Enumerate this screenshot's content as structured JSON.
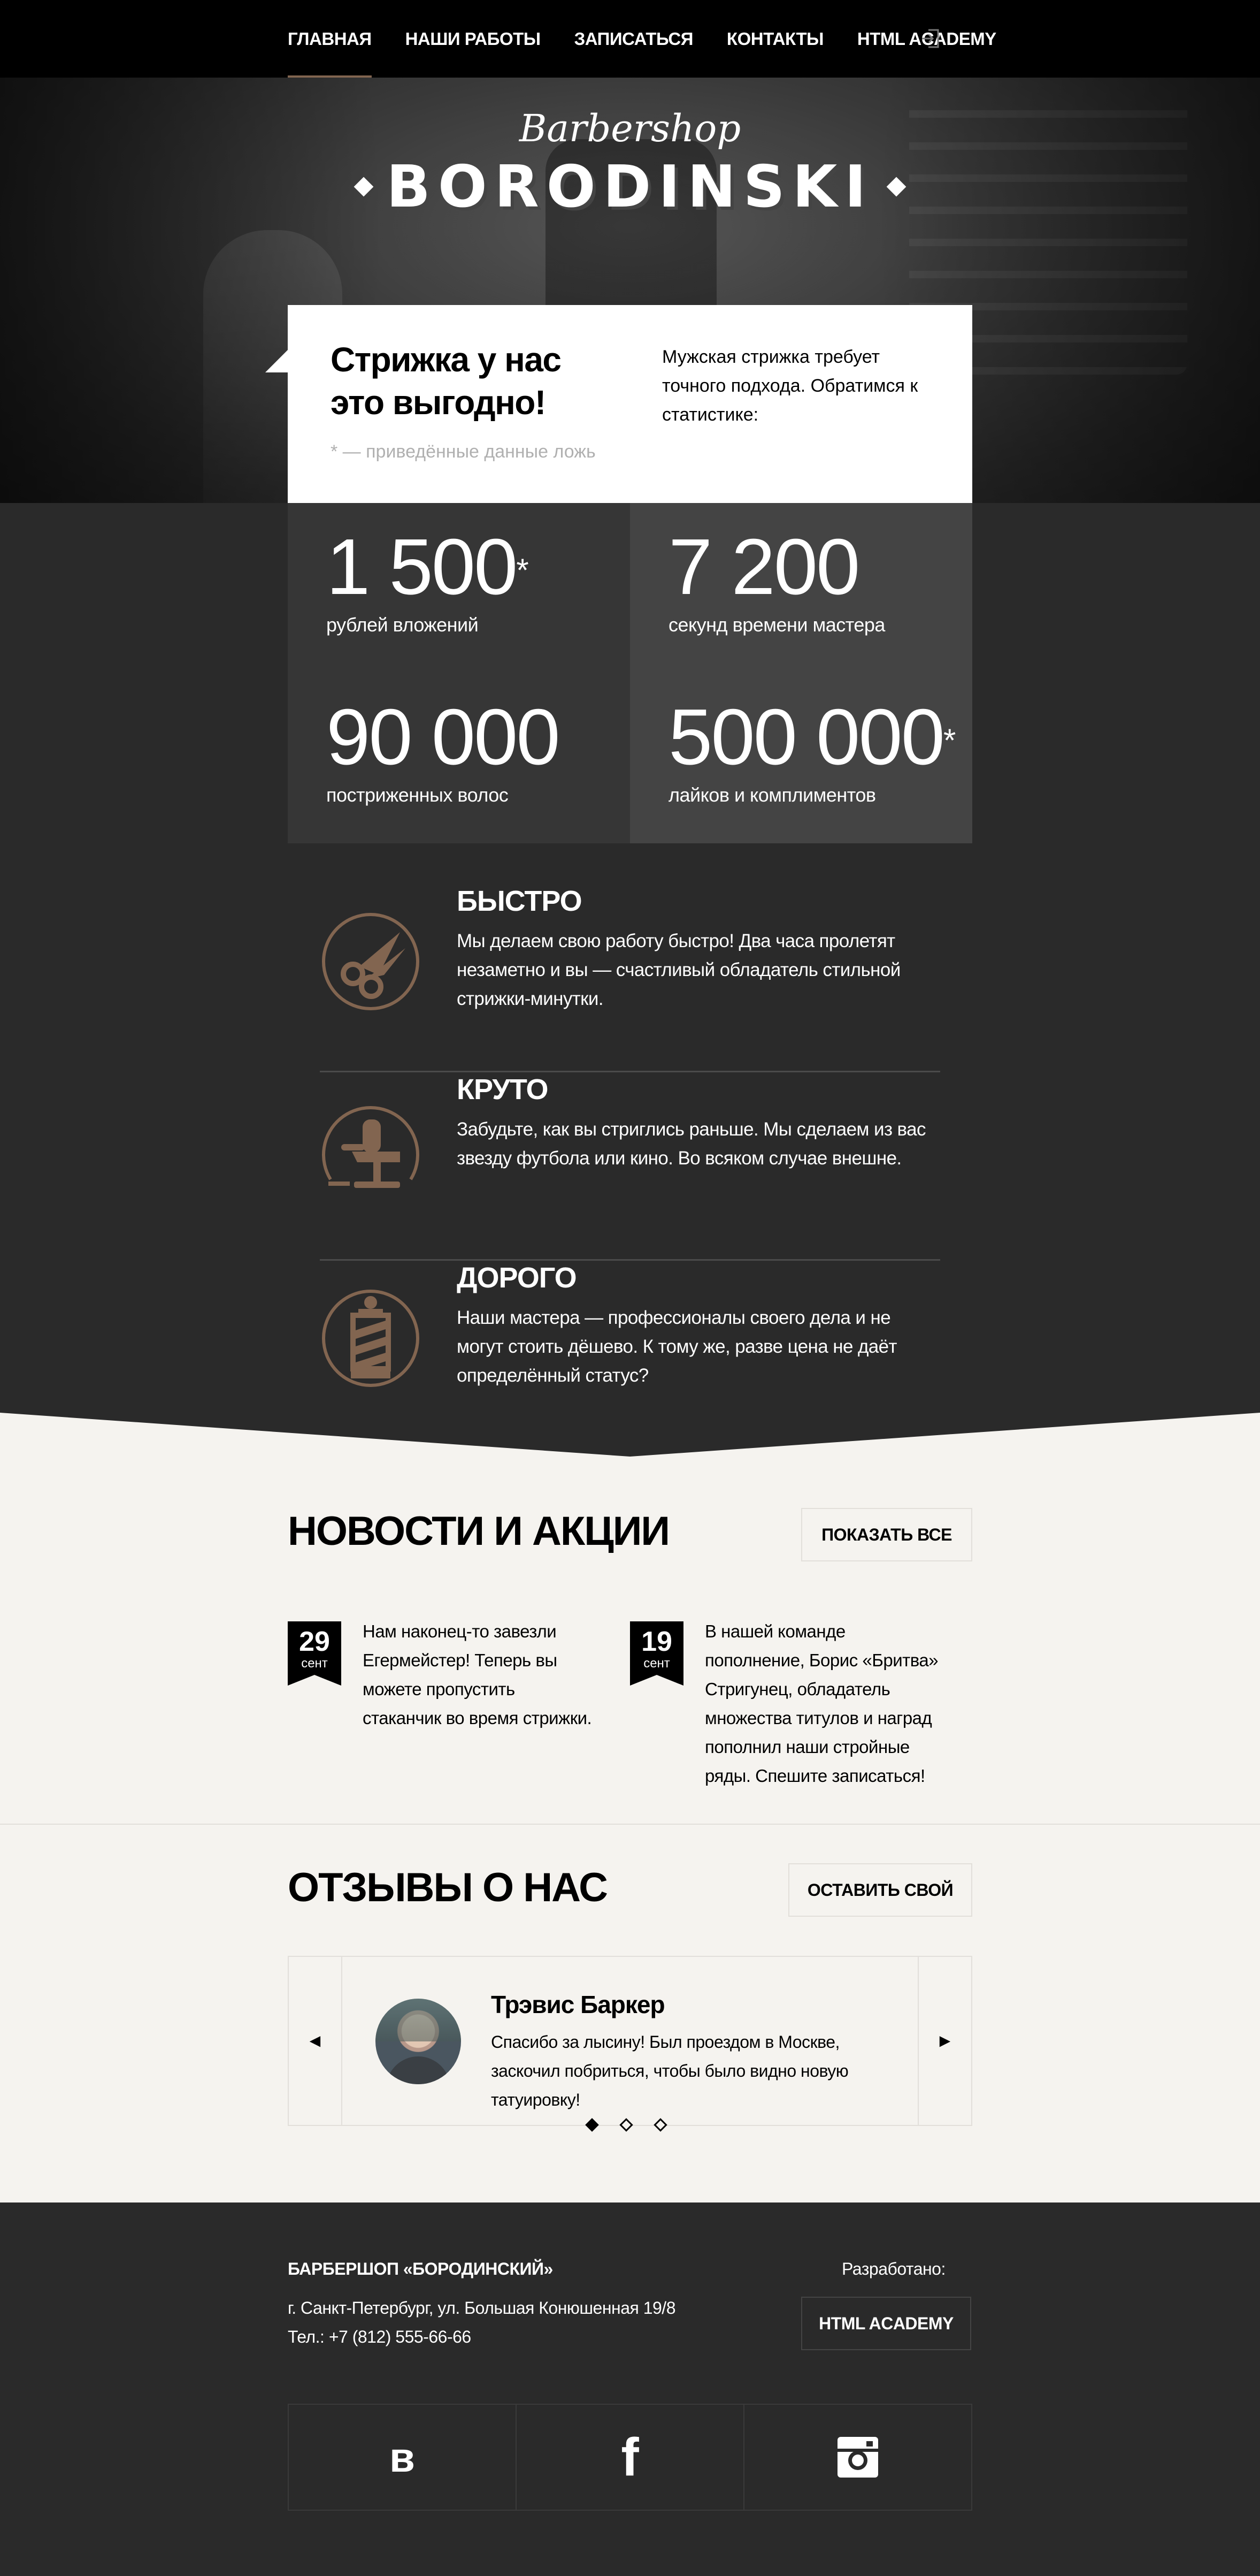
{
  "nav": {
    "items": [
      {
        "label": "ГЛАВНАЯ",
        "active": true
      },
      {
        "label": "НАШИ РАБОТЫ",
        "active": false
      },
      {
        "label": "ЗАПИСАТЬСЯ",
        "active": false
      },
      {
        "label": "КОНТАКТЫ",
        "active": false
      },
      {
        "label": "HTML ACADEMY",
        "active": false
      }
    ],
    "login_icon": "login-icon"
  },
  "logo": {
    "script": "Barbershop",
    "brand": "BORODINSKI"
  },
  "intro": {
    "title": "Стрижка у нас это выгодно!",
    "note": "* — приведённые данные ложь",
    "description": "Мужская стрижка требует точного подхода. Обратимся к статистике:"
  },
  "stats": [
    {
      "value": "1 500",
      "asterisk": "*",
      "label": "рублей вложений"
    },
    {
      "value": "7 200",
      "asterisk": "",
      "label": "секунд времени мастера"
    },
    {
      "value": "90 000",
      "asterisk": "",
      "label": "постриженных волос"
    },
    {
      "value": "500 000",
      "asterisk": "*",
      "label": "лайков и комплиментов"
    }
  ],
  "features": [
    {
      "icon": "scissors-icon",
      "title": "БЫСТРО",
      "text": "Мы делаем свою работу быстро! Два часа пролетят незаметно и вы — счастливый обладатель стильной стрижки-минутки."
    },
    {
      "icon": "barber-chair-icon",
      "title": "КРУТО",
      "text": "Забудьте, как вы стриглись раньше. Мы сделаем из вас звезду футбола или кино. Во всяком случае внешне."
    },
    {
      "icon": "barber-pole-icon",
      "title": "ДОРОГО",
      "text": "Наши мастера — профессионалы своего дела и не могут стоить дёшево. К тому же, разве цена не даёт определённый статус?"
    }
  ],
  "colors": {
    "accent": "#826550",
    "dark_bg": "#2a2a2a",
    "light_bg": "#f5f3ef",
    "stat_dark": "#363636",
    "stat_light": "#444444"
  },
  "news": {
    "title": "НОВОСТИ И АКЦИИ",
    "button": "ПОКАЗАТЬ ВСЕ",
    "items": [
      {
        "day": "29",
        "month": "сент",
        "text": "Нам наконец-то завезли Егермейстер! Теперь вы можете пропустить стаканчик во время стрижки."
      },
      {
        "day": "19",
        "month": "сент",
        "text": "В нашей команде пополнение, Борис «Бритва» Стригунец, обладатель множества титулов и наград пополнил наши стройные ряды. Спешите записаться!"
      }
    ]
  },
  "reviews": {
    "title": "ОТЗЫВЫ О НАС",
    "button": "ОСТАВИТЬ СВОЙ",
    "prev_arrow": "◄",
    "next_arrow": "►",
    "items": [
      {
        "name": "Трэвис Баркер",
        "text": "Спасибо за лысину! Был проездом в Москве, заскочил побриться, чтобы было видно новую татуировку!"
      }
    ],
    "slides_total": 3,
    "slide_active": 1
  },
  "footer": {
    "org": "БАРБЕРШОП «БОРОДИНСКИЙ»",
    "address": "г. Санкт-Петербург, ул. Большая Конюшенная 19/8",
    "phone": "Тел.: +7 (812) 555-66-66",
    "developed_by": "Разработано:",
    "academy": "HTML ACADEMY",
    "social": [
      {
        "icon": "vk-icon",
        "label": "в"
      },
      {
        "icon": "facebook-icon",
        "label": "f"
      },
      {
        "icon": "instagram-icon",
        "label": ""
      }
    ]
  }
}
